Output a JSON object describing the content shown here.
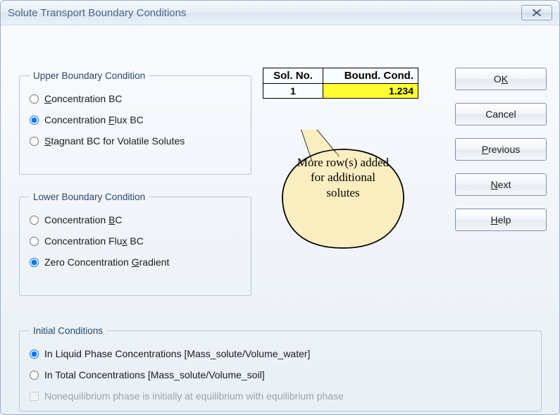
{
  "title": "Solute Transport Boundary Conditions",
  "groups": {
    "upper": {
      "legend": "Upper Boundary Condition",
      "options": [
        {
          "label_pre": "",
          "accel": "C",
          "label_post": "oncentration BC",
          "selected": false
        },
        {
          "label_pre": "Concentration ",
          "accel": "F",
          "label_post": "lux BC",
          "selected": true
        },
        {
          "label_pre": "",
          "accel": "S",
          "label_post": "tagnant BC for Volatile Solutes",
          "selected": false
        }
      ]
    },
    "lower": {
      "legend": "Lower Boundary Condition",
      "options": [
        {
          "label_pre": "Concentration ",
          "accel": "B",
          "label_post": "C",
          "selected": false
        },
        {
          "label_pre": "Concentration Flu",
          "accel": "x",
          "label_post": " BC",
          "selected": false
        },
        {
          "label_pre": "Zero Concentration ",
          "accel": "G",
          "label_post": "radient",
          "selected": true
        }
      ]
    },
    "init": {
      "legend": "Initial Conditions",
      "options": [
        {
          "label": "In Liquid Phase Concentrations [Mass_solute/Volume_water]",
          "selected": true
        },
        {
          "label": "In Total Concentrations [Mass_solute/Volume_soil]",
          "selected": false
        }
      ],
      "checkbox": {
        "label": "Nonequilibrium phase is initially at equilibrium with equilibrium phase",
        "checked": false,
        "enabled": false
      }
    }
  },
  "table": {
    "headers": {
      "sol": "Sol. No.",
      "bc": "Bound. Cond."
    },
    "rows": [
      {
        "sol": "1",
        "bc": "1.234"
      }
    ]
  },
  "buttons": {
    "ok": {
      "pre": "O",
      "accel": "K",
      "post": ""
    },
    "cancel": {
      "label": "Cancel"
    },
    "previous": {
      "pre": "",
      "accel": "P",
      "post": "revious"
    },
    "next": {
      "pre": "",
      "accel": "N",
      "post": "ext"
    },
    "help": {
      "pre": "",
      "accel": "H",
      "post": "elp"
    }
  },
  "callout": "More row(s) added for additional solutes"
}
